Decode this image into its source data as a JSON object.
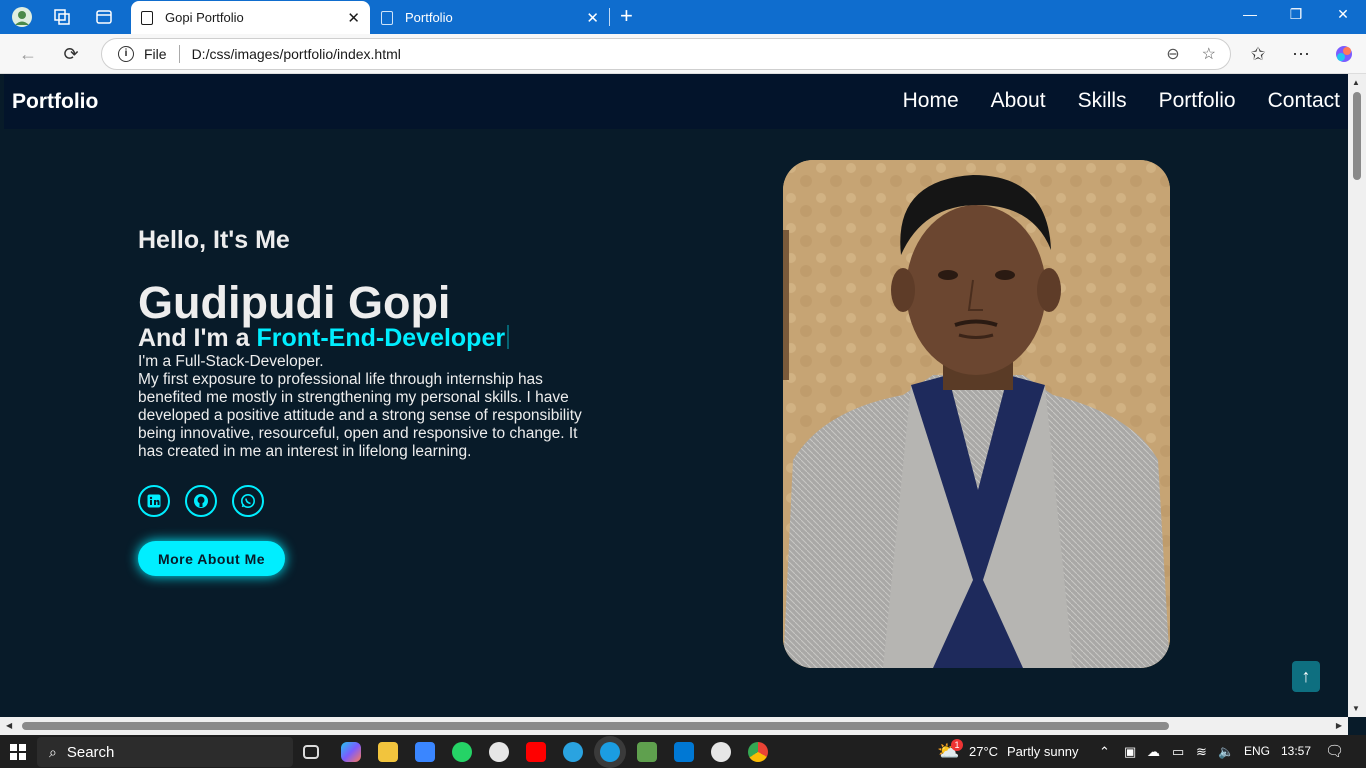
{
  "browser": {
    "tabs": [
      {
        "title": "Gopi Portfolio",
        "active": true
      },
      {
        "title": "Portfolio",
        "active": false
      }
    ],
    "address": {
      "scheme_label": "File",
      "url": "D:/css/images/portfolio/index.html"
    }
  },
  "site": {
    "logo": "Portfolio",
    "nav": [
      "Home",
      "About",
      "Skills",
      "Portfolio",
      "Contact"
    ],
    "hero": {
      "greeting": "Hello, It's Me",
      "name": "Gudipudi Gopi",
      "role_prefix": "And I'm a ",
      "role_typed": "Front-End-Developer",
      "tagline": "I'm a Full-Stack-Developer.",
      "paragraph": "My first exposure to professional life through internship has benefited me mostly in strengthening my personal skills. I have developed a positive attitude and a strong sense of responsibility being innovative, resourceful, open and responsive to change. It has created in me an interest in lifelong learning.",
      "socials": [
        "linkedin-icon",
        "github-icon",
        "whatsapp-icon"
      ],
      "button_label": "More About Me"
    },
    "colors": {
      "accent": "#00eeff",
      "background": "#081b29",
      "navbar": "#03142b"
    }
  },
  "taskbar": {
    "search_label": "Search",
    "weather": {
      "temp": "27°C",
      "condition": "Partly sunny",
      "badge": "1"
    },
    "language": "ENG",
    "time": "13:57"
  }
}
